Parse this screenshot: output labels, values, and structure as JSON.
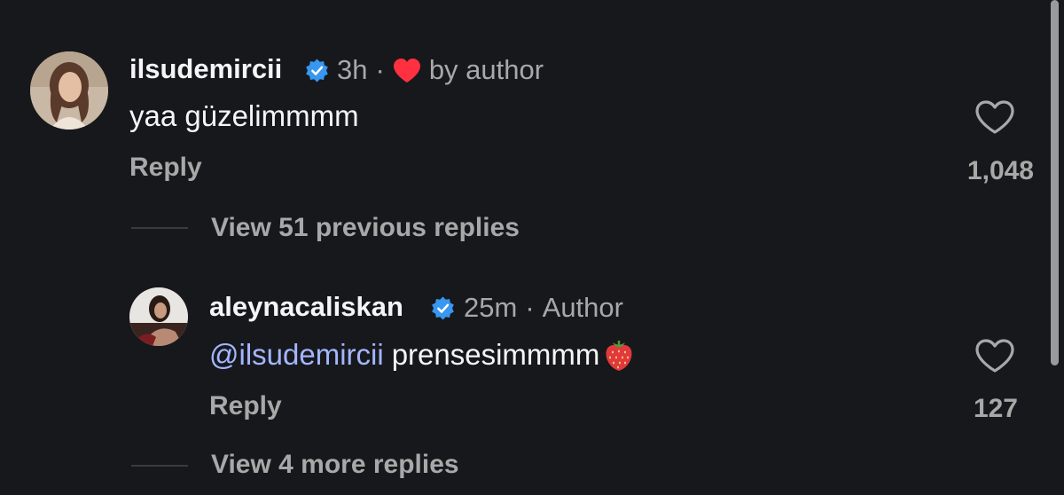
{
  "colors": {
    "background": "#17181c",
    "primary_text": "#f5f5f5",
    "secondary_text": "#a8a8a8",
    "mention": "#a3b6ff",
    "verified": "#3897f0",
    "heart_red": "#ff3040"
  },
  "comments": [
    {
      "username": "ilsudemircii",
      "verified": true,
      "time": "3h",
      "separator": "·",
      "liked_by_author_icon": "red-heart-icon",
      "badge": "by author",
      "text": "yaa güzelimmmm",
      "reply_label": "Reply",
      "like_icon": "heart-outline-icon",
      "like_count": "1,048",
      "view_replies": "View 51 previous replies"
    },
    {
      "username": "aleynacaliskan",
      "verified": true,
      "time": "25m",
      "separator": "·",
      "badge": "Author",
      "mention": "@ilsudemircii",
      "text": "prensesimmmm",
      "emoji": "🍓",
      "emoji_icon": "strawberry-icon",
      "reply_label": "Reply",
      "like_icon": "heart-outline-icon",
      "like_count": "127",
      "view_replies": "View 4 more replies"
    }
  ]
}
